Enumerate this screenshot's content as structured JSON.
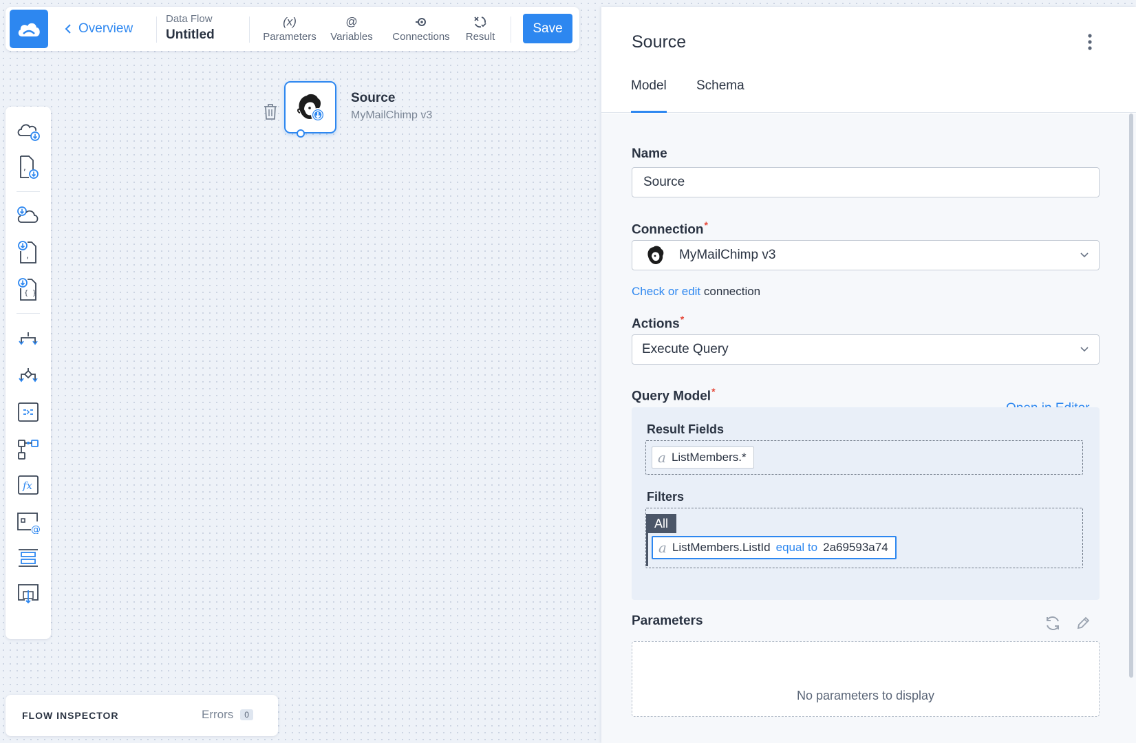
{
  "toolbar": {
    "back_label": "Overview",
    "flow_type": "Data Flow",
    "flow_name": "Untitled",
    "buttons": [
      {
        "label": "Parameters",
        "icon": "parameters-icon",
        "glyph": "(x)"
      },
      {
        "label": "Variables",
        "icon": "at-icon",
        "glyph": "@"
      },
      {
        "label": "Connections",
        "icon": "connections-icon"
      },
      {
        "label": "Result",
        "icon": "result-icon"
      }
    ],
    "save_label": "Save"
  },
  "node": {
    "title": "Source",
    "subtitle": "MyMailChimp v3",
    "icon": "mailchimp-source-icon"
  },
  "inspector": {
    "title": "FLOW INSPECTOR",
    "errors_label": "Errors",
    "errors_count": "0"
  },
  "panel": {
    "title": "Source",
    "tabs": [
      {
        "label": "Model",
        "active": true
      },
      {
        "label": "Schema",
        "active": false
      }
    ],
    "name_label": "Name",
    "name_value": "Source",
    "connection_label": "Connection",
    "connection_value": "MyMailChimp v3",
    "check_link": "Check or edit",
    "check_suffix": "connection",
    "actions_label": "Actions",
    "actions_value": "Execute Query",
    "query_model_label": "Query Model",
    "open_editor_label": "Open in Editor",
    "result_fields_label": "Result Fields",
    "result_field": "ListMembers.*",
    "filters_label": "Filters",
    "filter_group": "All",
    "filter": {
      "field": "ListMembers.ListId",
      "operator": "equal to",
      "value": "2a69593a74"
    },
    "parameters_label": "Parameters",
    "parameters_empty": "No parameters to display"
  },
  "colors": {
    "accent": "#2d87f0",
    "required": "#e5493a",
    "text": "#2a3342"
  }
}
